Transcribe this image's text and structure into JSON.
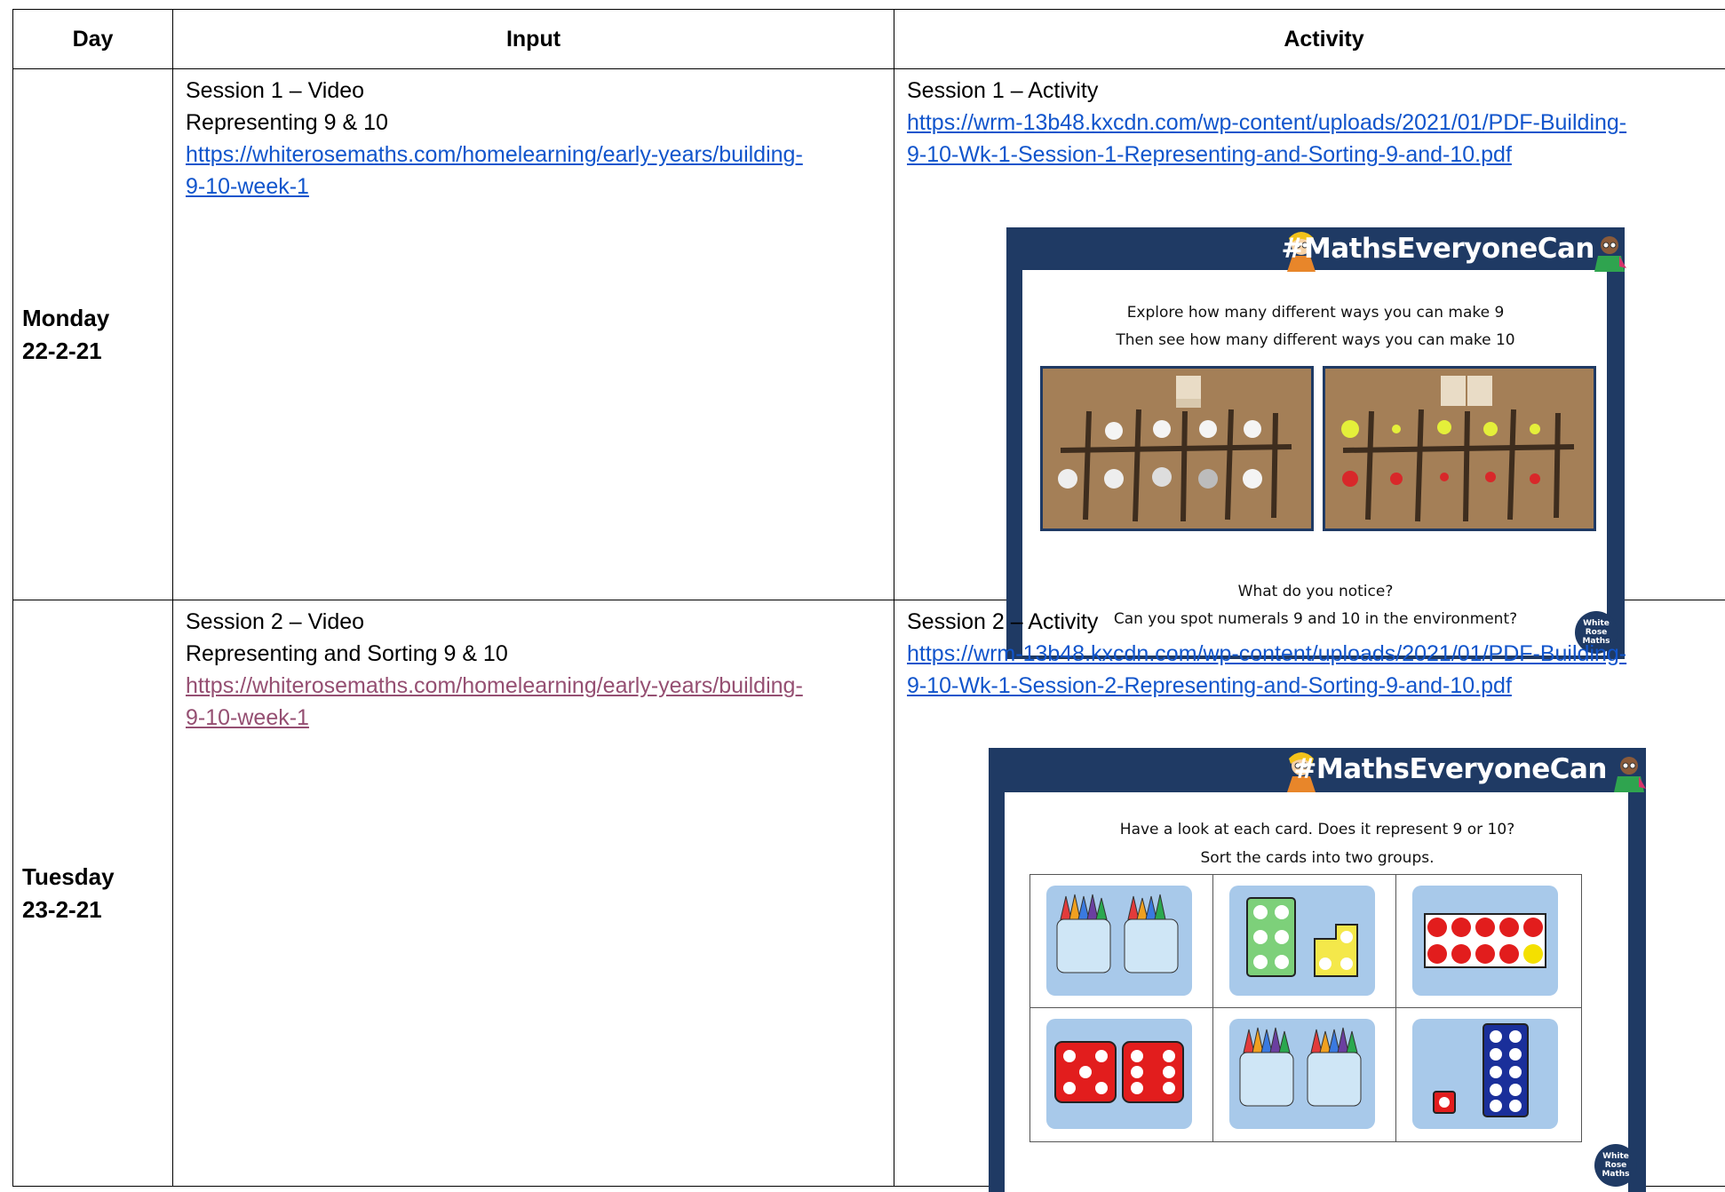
{
  "headers": {
    "day": "Day",
    "input": "Input",
    "activity": "Activity"
  },
  "rows": [
    {
      "day": "Monday",
      "date": "22-2-21",
      "input": {
        "session": "Session 1 – Video",
        "title": "Representing 9 & 10",
        "link_line1": "https://whiterosemaths.com/homelearning/early-years/building-",
        "link_line2": "9-10-week-1"
      },
      "activity": {
        "session": "Session 1 – Activity",
        "link_line1": "https://wrm-13b48.kxcdn.com/wp-content/uploads/2021/01/PDF-Building-",
        "link_line2": "9-10-Wk-1-Session-1-Representing-and-Sorting-9-and-10.pdf",
        "slide": {
          "brand": "#MathsEveryoneCan",
          "line1": "Explore how many different ways you can make 9",
          "line2": "Then see how many different ways you can make 10",
          "line3": "What do you notice?",
          "line4": "Can you spot numerals 9 and 10 in the environment?",
          "logo": "White Rose Maths"
        }
      }
    },
    {
      "day": "Tuesday",
      "date": "23-2-21",
      "input": {
        "session": "Session 2 – Video",
        "title": "Representing and Sorting 9 & 10",
        "link_line1": "https://whiterosemaths.com/homelearning/early-years/building-",
        "link_line2": "9-10-week-1"
      },
      "activity": {
        "session": "Session 2 – Activity",
        "link_line1": "https://wrm-13b48.kxcdn.com/wp-content/uploads/2021/01/PDF-Building-",
        "link_line2": "9-10-Wk-1-Session-2-Representing-and-Sorting-9-and-10.pdf",
        "slide": {
          "brand": "#MathsEveryoneCan",
          "line1": "Have a look at each card. Does it represent 9 or 10?",
          "line2": "Sort the cards into two groups.",
          "logo": "White Rose Maths"
        }
      }
    }
  ],
  "colors": {
    "navy": "#1f3a64",
    "link": "#1155cc",
    "visited_link": "#954f72",
    "card": "#a8c9ea"
  }
}
